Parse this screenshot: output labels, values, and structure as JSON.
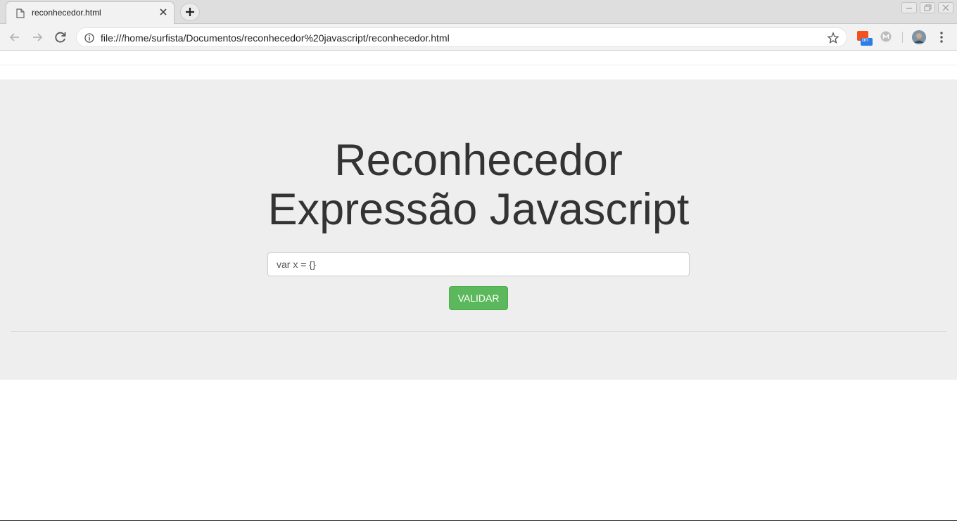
{
  "browser": {
    "tab_title": "reconhecedor.html",
    "url": "file:///home/surfista/Documentos/reconhecedor%20javascript/reconhecedor.html",
    "extension_badge": "on"
  },
  "page": {
    "heading_line1": "Reconhecedor",
    "heading_line2": "Expressão Javascript",
    "input_value": "var x = {}",
    "button_label": "VALIDAR"
  },
  "colors": {
    "jumbotron_bg": "#eeeeee",
    "button_bg": "#5cb85c",
    "heading_color": "#333333"
  },
  "icons": [
    "page-icon",
    "close-icon",
    "plus-icon",
    "back-icon",
    "forward-icon",
    "reload-icon",
    "info-icon",
    "star-icon",
    "extension-icon",
    "m-extension-icon",
    "avatar",
    "menu-icon",
    "minimize-icon",
    "restore-icon",
    "window-close-icon"
  ]
}
